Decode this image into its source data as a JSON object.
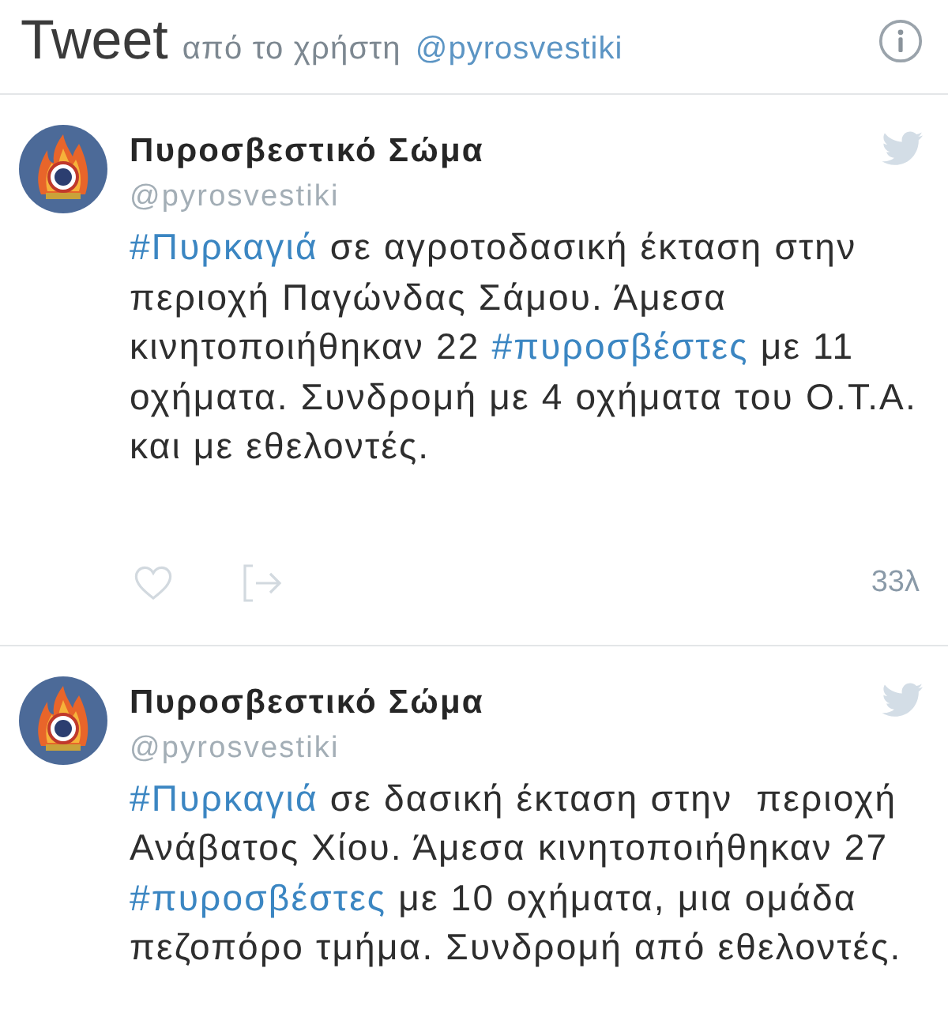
{
  "header": {
    "title": "Tweet",
    "subtitle": "από το χρήστη",
    "handle": "@pyrosvestiki"
  },
  "tweets": [
    {
      "name": "Πυροσβεστικό Σώμα",
      "handle": "@pyrosvestiki",
      "text": [
        {
          "kind": "hashtag",
          "text": "#Πυρκαγιά"
        },
        {
          "kind": "plain",
          "text": " σε αγροτοδασική έκταση στην περιοχή Παγώνδας Σάμου. Άμεσα κινητοποιήθηκαν 22 "
        },
        {
          "kind": "hashtag",
          "text": "#πυροσβέστες"
        },
        {
          "kind": "plain",
          "text": " με 11 οχήματα. Συνδρομή με 4 οχήματα του Ο.Τ.Α. και με εθελοντές."
        }
      ],
      "footer": {
        "time": "33λ"
      }
    },
    {
      "name": "Πυροσβεστικό Σώμα",
      "handle": "@pyrosvestiki",
      "text": [
        {
          "kind": "hashtag",
          "text": "#Πυρκαγιά"
        },
        {
          "kind": "plain",
          "text": " σε δασική έκταση στην  περιοχή Ανάβατος Χίου. Άμεσα κινητοποιήθηκαν 27 "
        },
        {
          "kind": "hashtag",
          "text": "#πυροσβέστες"
        },
        {
          "kind": "plain",
          "text": " με 10 οχήματα, μια ομάδα πεζοπόρο τμήμα. Συνδρομή από εθελοντές."
        }
      ]
    }
  ]
}
